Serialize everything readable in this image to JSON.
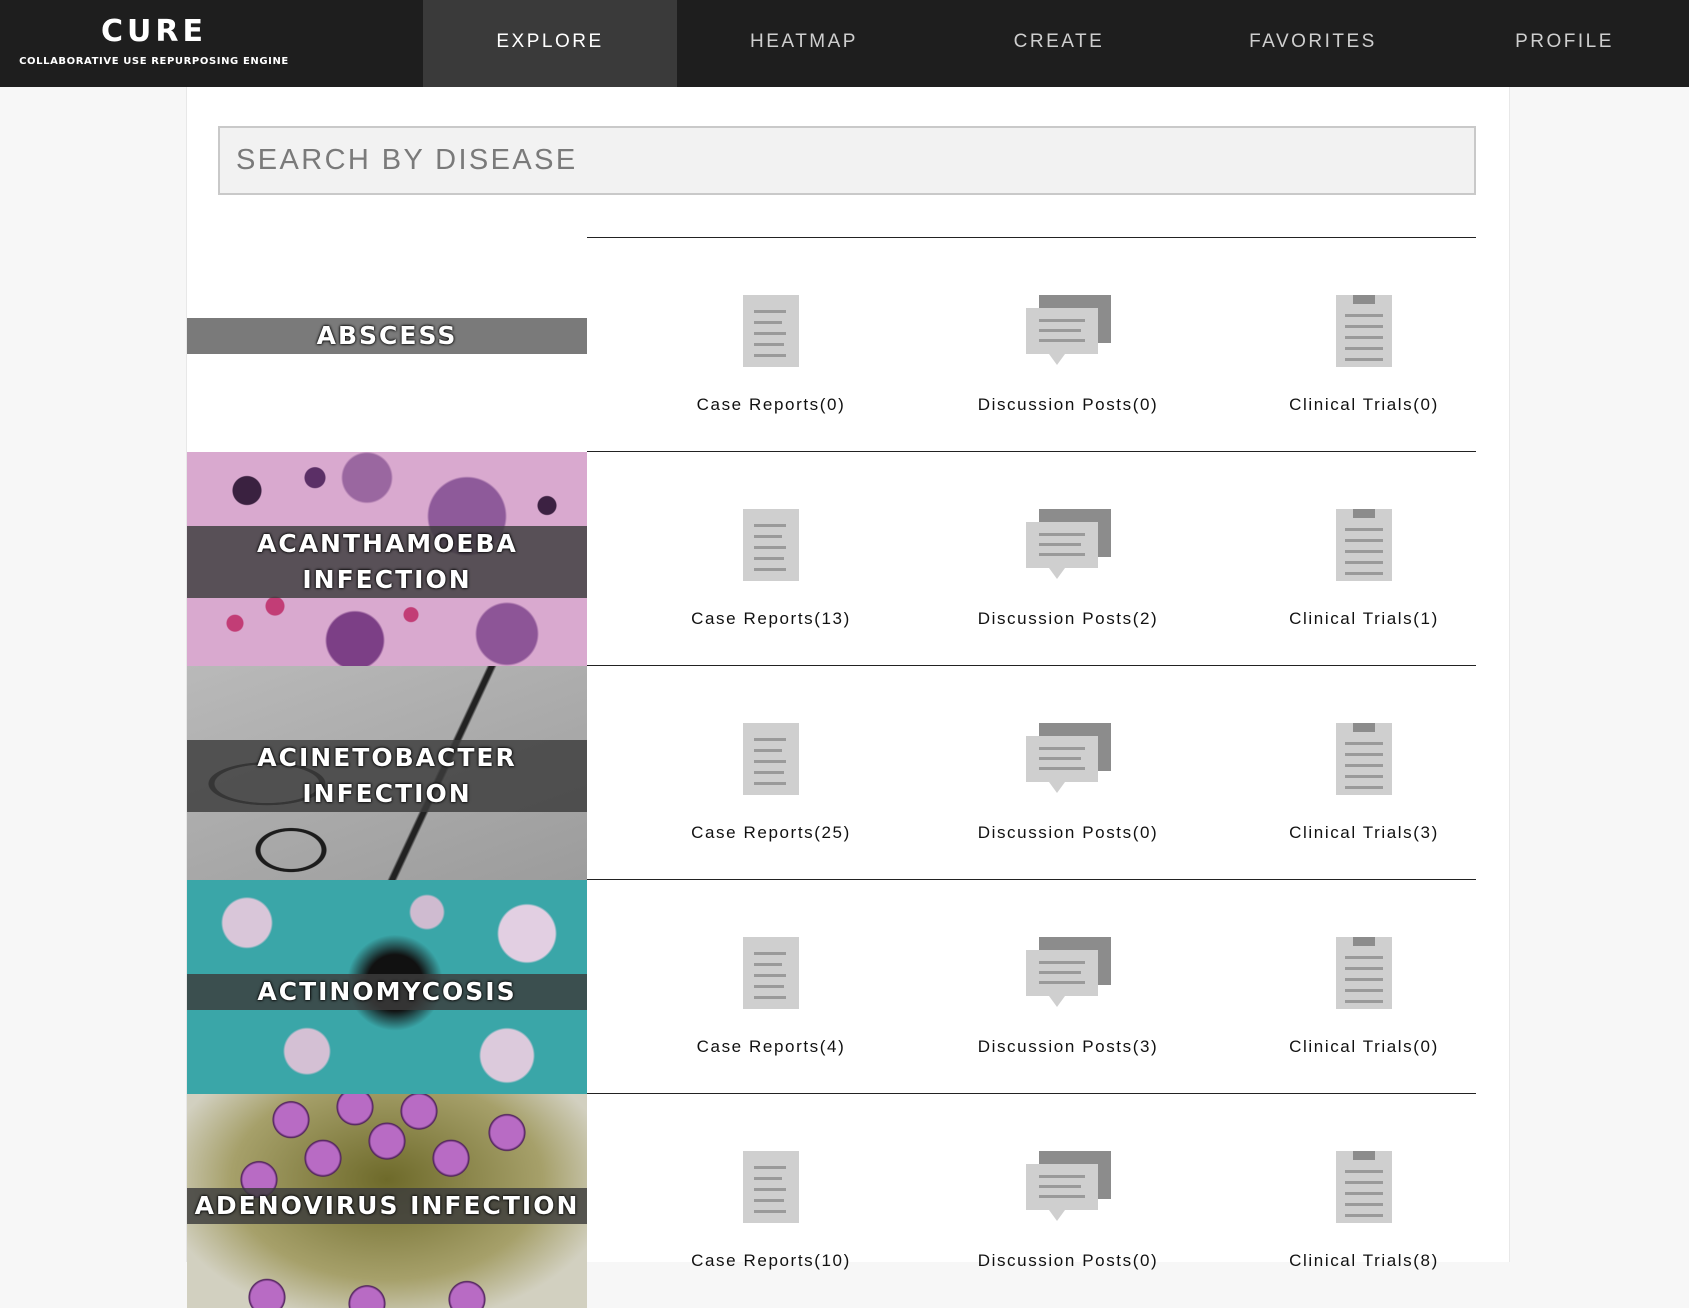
{
  "brand": {
    "name": "CURE",
    "tagline": "COLLABORATIVE USE REPURPOSING ENGINE"
  },
  "nav": {
    "tabs": [
      "EXPLORE",
      "HEATMAP",
      "CREATE",
      "FAVORITES",
      "PROFILE"
    ],
    "active": "EXPLORE"
  },
  "search": {
    "placeholder": "SEARCH BY DISEASE"
  },
  "diseases": [
    {
      "name": "ABSCESS",
      "case_reports": "Case Reports(0)",
      "discussion_posts": "Discussion Posts(0)",
      "clinical_trials": "Clinical Trials(0)"
    },
    {
      "name": "ACANTHAMOEBA INFECTION",
      "case_reports": "Case Reports(13)",
      "discussion_posts": "Discussion Posts(2)",
      "clinical_trials": "Clinical Trials(1)"
    },
    {
      "name": "ACINETOBACTER INFECTION",
      "case_reports": "Case Reports(25)",
      "discussion_posts": "Discussion Posts(0)",
      "clinical_trials": "Clinical Trials(3)"
    },
    {
      "name": "ACTINOMYCOSIS",
      "case_reports": "Case Reports(4)",
      "discussion_posts": "Discussion Posts(3)",
      "clinical_trials": "Clinical Trials(0)"
    },
    {
      "name": "ADENOVIRUS INFECTION",
      "case_reports": "Case Reports(10)",
      "discussion_posts": "Discussion Posts(0)",
      "clinical_trials": "Clinical Trials(8)"
    }
  ],
  "icons": {
    "case_reports": "document-icon",
    "discussion_posts": "chat-bubbles-icon",
    "clinical_trials": "clipboard-icon"
  }
}
